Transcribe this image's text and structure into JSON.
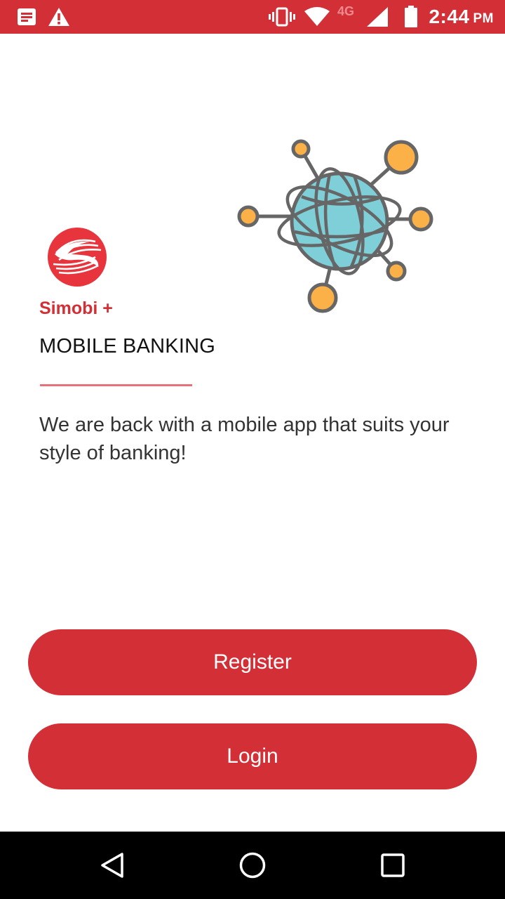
{
  "status_bar": {
    "time": "2:44",
    "ampm": "PM",
    "network": "4G",
    "icons": [
      "notification-icon",
      "warning-icon",
      "vibrate-icon",
      "wifi-icon",
      "signal-icon",
      "battery-icon"
    ]
  },
  "brand": {
    "name": "Simobi +",
    "logo_icon": "simobi-logo-icon",
    "accent_color": "#d32f36"
  },
  "hero": {
    "illustration_icon": "globe-network-icon",
    "headline": "MOBILE BANKING",
    "tagline": "We are back with a mobile app that suits your style of banking!"
  },
  "actions": {
    "register_label": "Register",
    "login_label": "Login"
  },
  "nav_bar": {
    "icons": [
      "back-icon",
      "home-icon",
      "recents-icon"
    ]
  }
}
